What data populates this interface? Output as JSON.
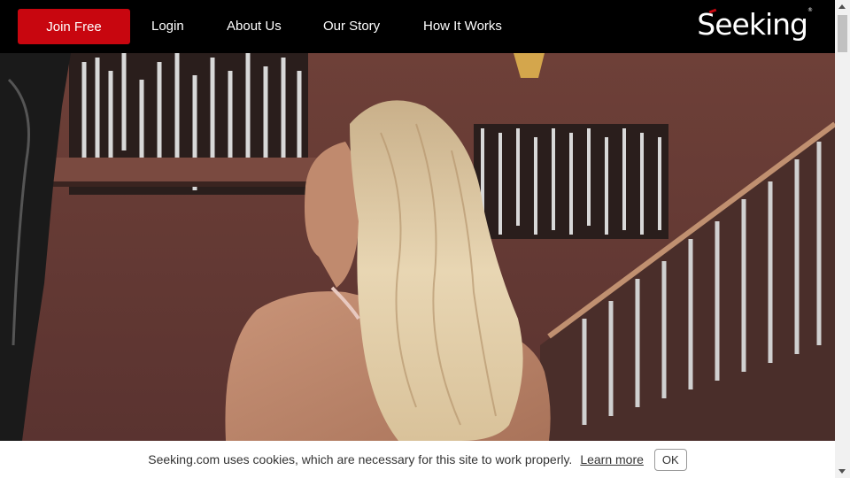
{
  "nav": {
    "join_label": "Join Free",
    "links": [
      "Login",
      "About Us",
      "Our Story",
      "How It Works"
    ],
    "logo_text": "Seeking",
    "logo_mark": "®"
  },
  "hero": {
    "image": "photo-woman-blonde-hair-staircase-lobby"
  },
  "cookie": {
    "message": "Seeking.com uses cookies, which are necessary for this site to work properly.",
    "learn_more": "Learn more",
    "ok_label": "OK"
  },
  "colors": {
    "accent": "#c8060f",
    "nav_bg": "#000000",
    "cookie_bg": "#ffffff"
  }
}
